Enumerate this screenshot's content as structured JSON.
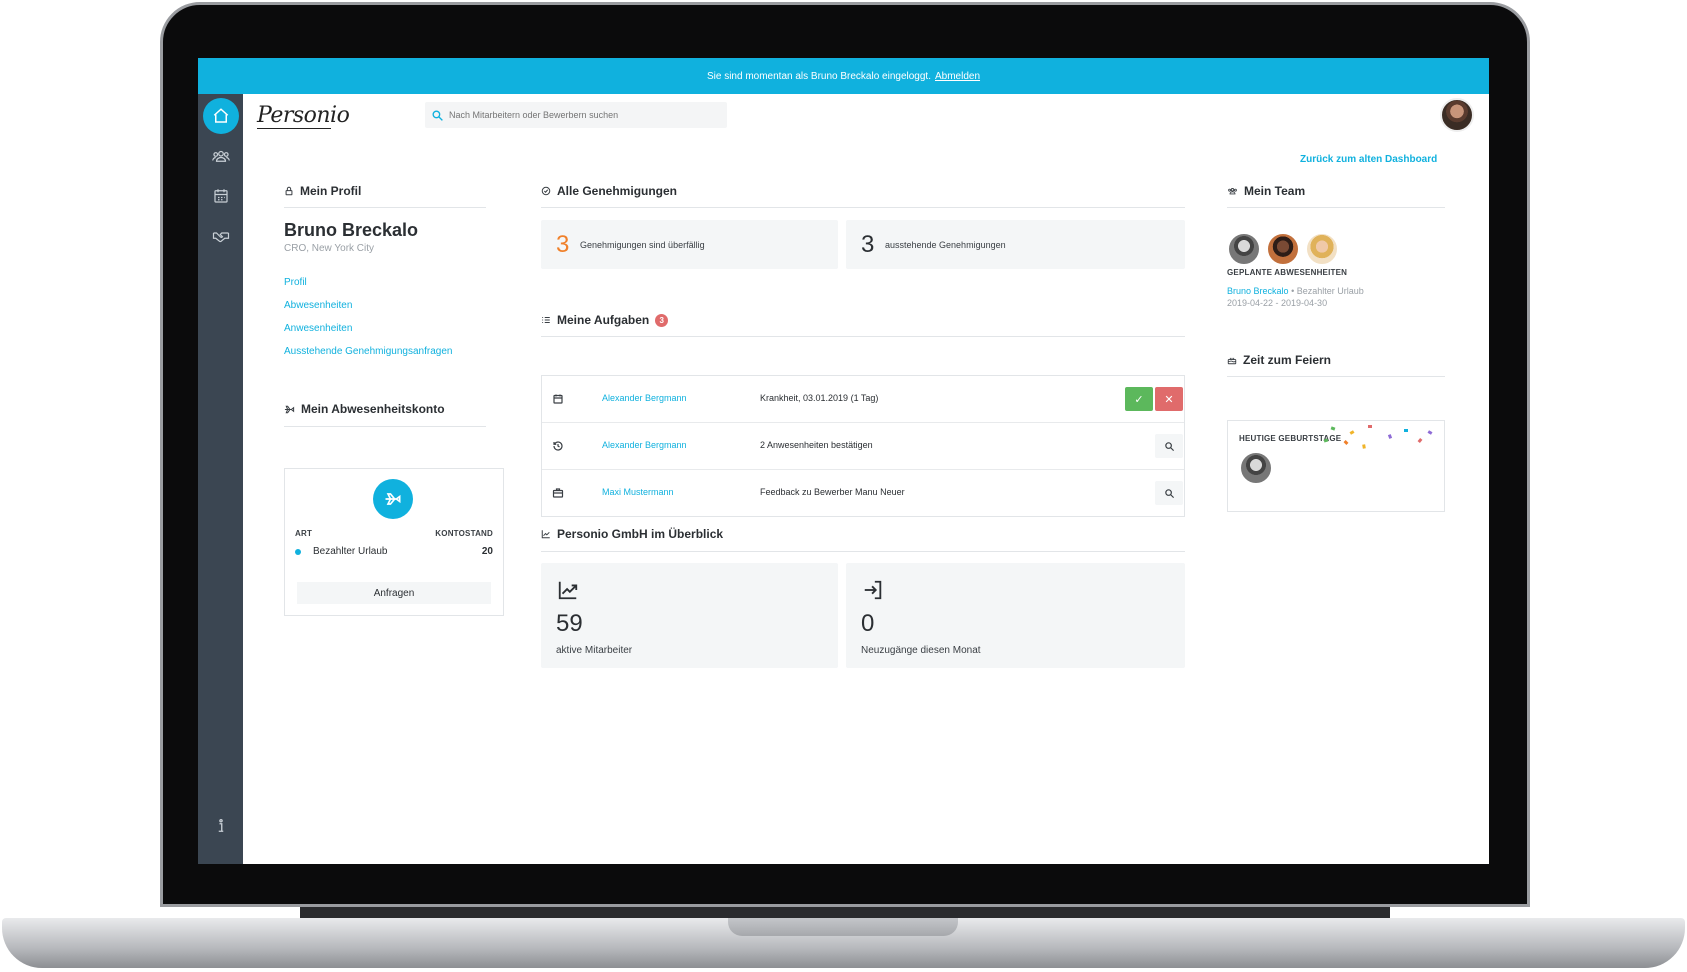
{
  "banner": {
    "text": "Sie sind momentan als Bruno Breckalo eingeloggt.",
    "logout": "Abmelden"
  },
  "topbar": {
    "logo": "Personio",
    "search_placeholder": "Nach Mitarbeitern oder Bewerbern suchen"
  },
  "back_link": "Zurück zum alten Dashboard",
  "nav": {
    "items": [
      "home-icon",
      "people-icon",
      "calendar-icon",
      "handshake-icon"
    ],
    "info": "info-icon"
  },
  "profile": {
    "title": "Mein Profil",
    "name": "Bruno Breckalo",
    "role": "CRO, New York City",
    "links": [
      "Profil",
      "Abwesenheiten",
      "Anwesenheiten",
      "Ausstehende Genehmigungsanfragen"
    ]
  },
  "account": {
    "title": "Mein Abwesenheitskonto",
    "col_type": "ART",
    "col_balance": "KONTOSTAND",
    "row_label": "Bezahlter Urlaub",
    "row_value": "20",
    "button": "Anfragen",
    "accent": "#10b1de"
  },
  "approvals": {
    "title": "Alle Genehmigungen",
    "overdue_count": "3",
    "overdue_label": "Genehmigungen sind überfällig",
    "pending_count": "3",
    "pending_label": "ausstehende Genehmigungen",
    "overdue_color": "#f0802a"
  },
  "tasks": {
    "title": "Meine Aufgaben",
    "badge": "3",
    "rows": [
      {
        "icon": "calendar-icon",
        "name": "Alexander Bergmann",
        "desc": "Krankheit, 03.01.2019 (1 Tag)",
        "actions": "approve-reject"
      },
      {
        "icon": "history-icon",
        "name": "Alexander Bergmann",
        "desc": "2 Anwesenheiten bestätigen",
        "actions": "search"
      },
      {
        "icon": "briefcase-icon",
        "name": "Maxi Mustermann",
        "desc": "Feedback zu Bewerber Manu Neuer",
        "actions": "search"
      }
    ]
  },
  "overview": {
    "title": "Personio GmbH im Überblick",
    "active_count": "59",
    "active_label": "aktive Mitarbeiter",
    "new_count": "0",
    "new_label": "Neuzugänge diesen Monat"
  },
  "team": {
    "title": "Mein Team",
    "planned_title": "GEPLANTE ABWESENHEITEN",
    "absence_name": "Bruno Breckalo",
    "absence_type": "• Bezahlter Urlaub",
    "absence_dates": "2019-04-22 - 2019-04-30"
  },
  "celebrate": {
    "title": "Zeit zum Feiern",
    "birthdays": "HEUTIGE GEBURTSTAGE"
  },
  "colors": {
    "brand": "#10b1de",
    "nav": "#3b4652",
    "approve": "#5cb85c",
    "reject": "#e06b6b"
  }
}
